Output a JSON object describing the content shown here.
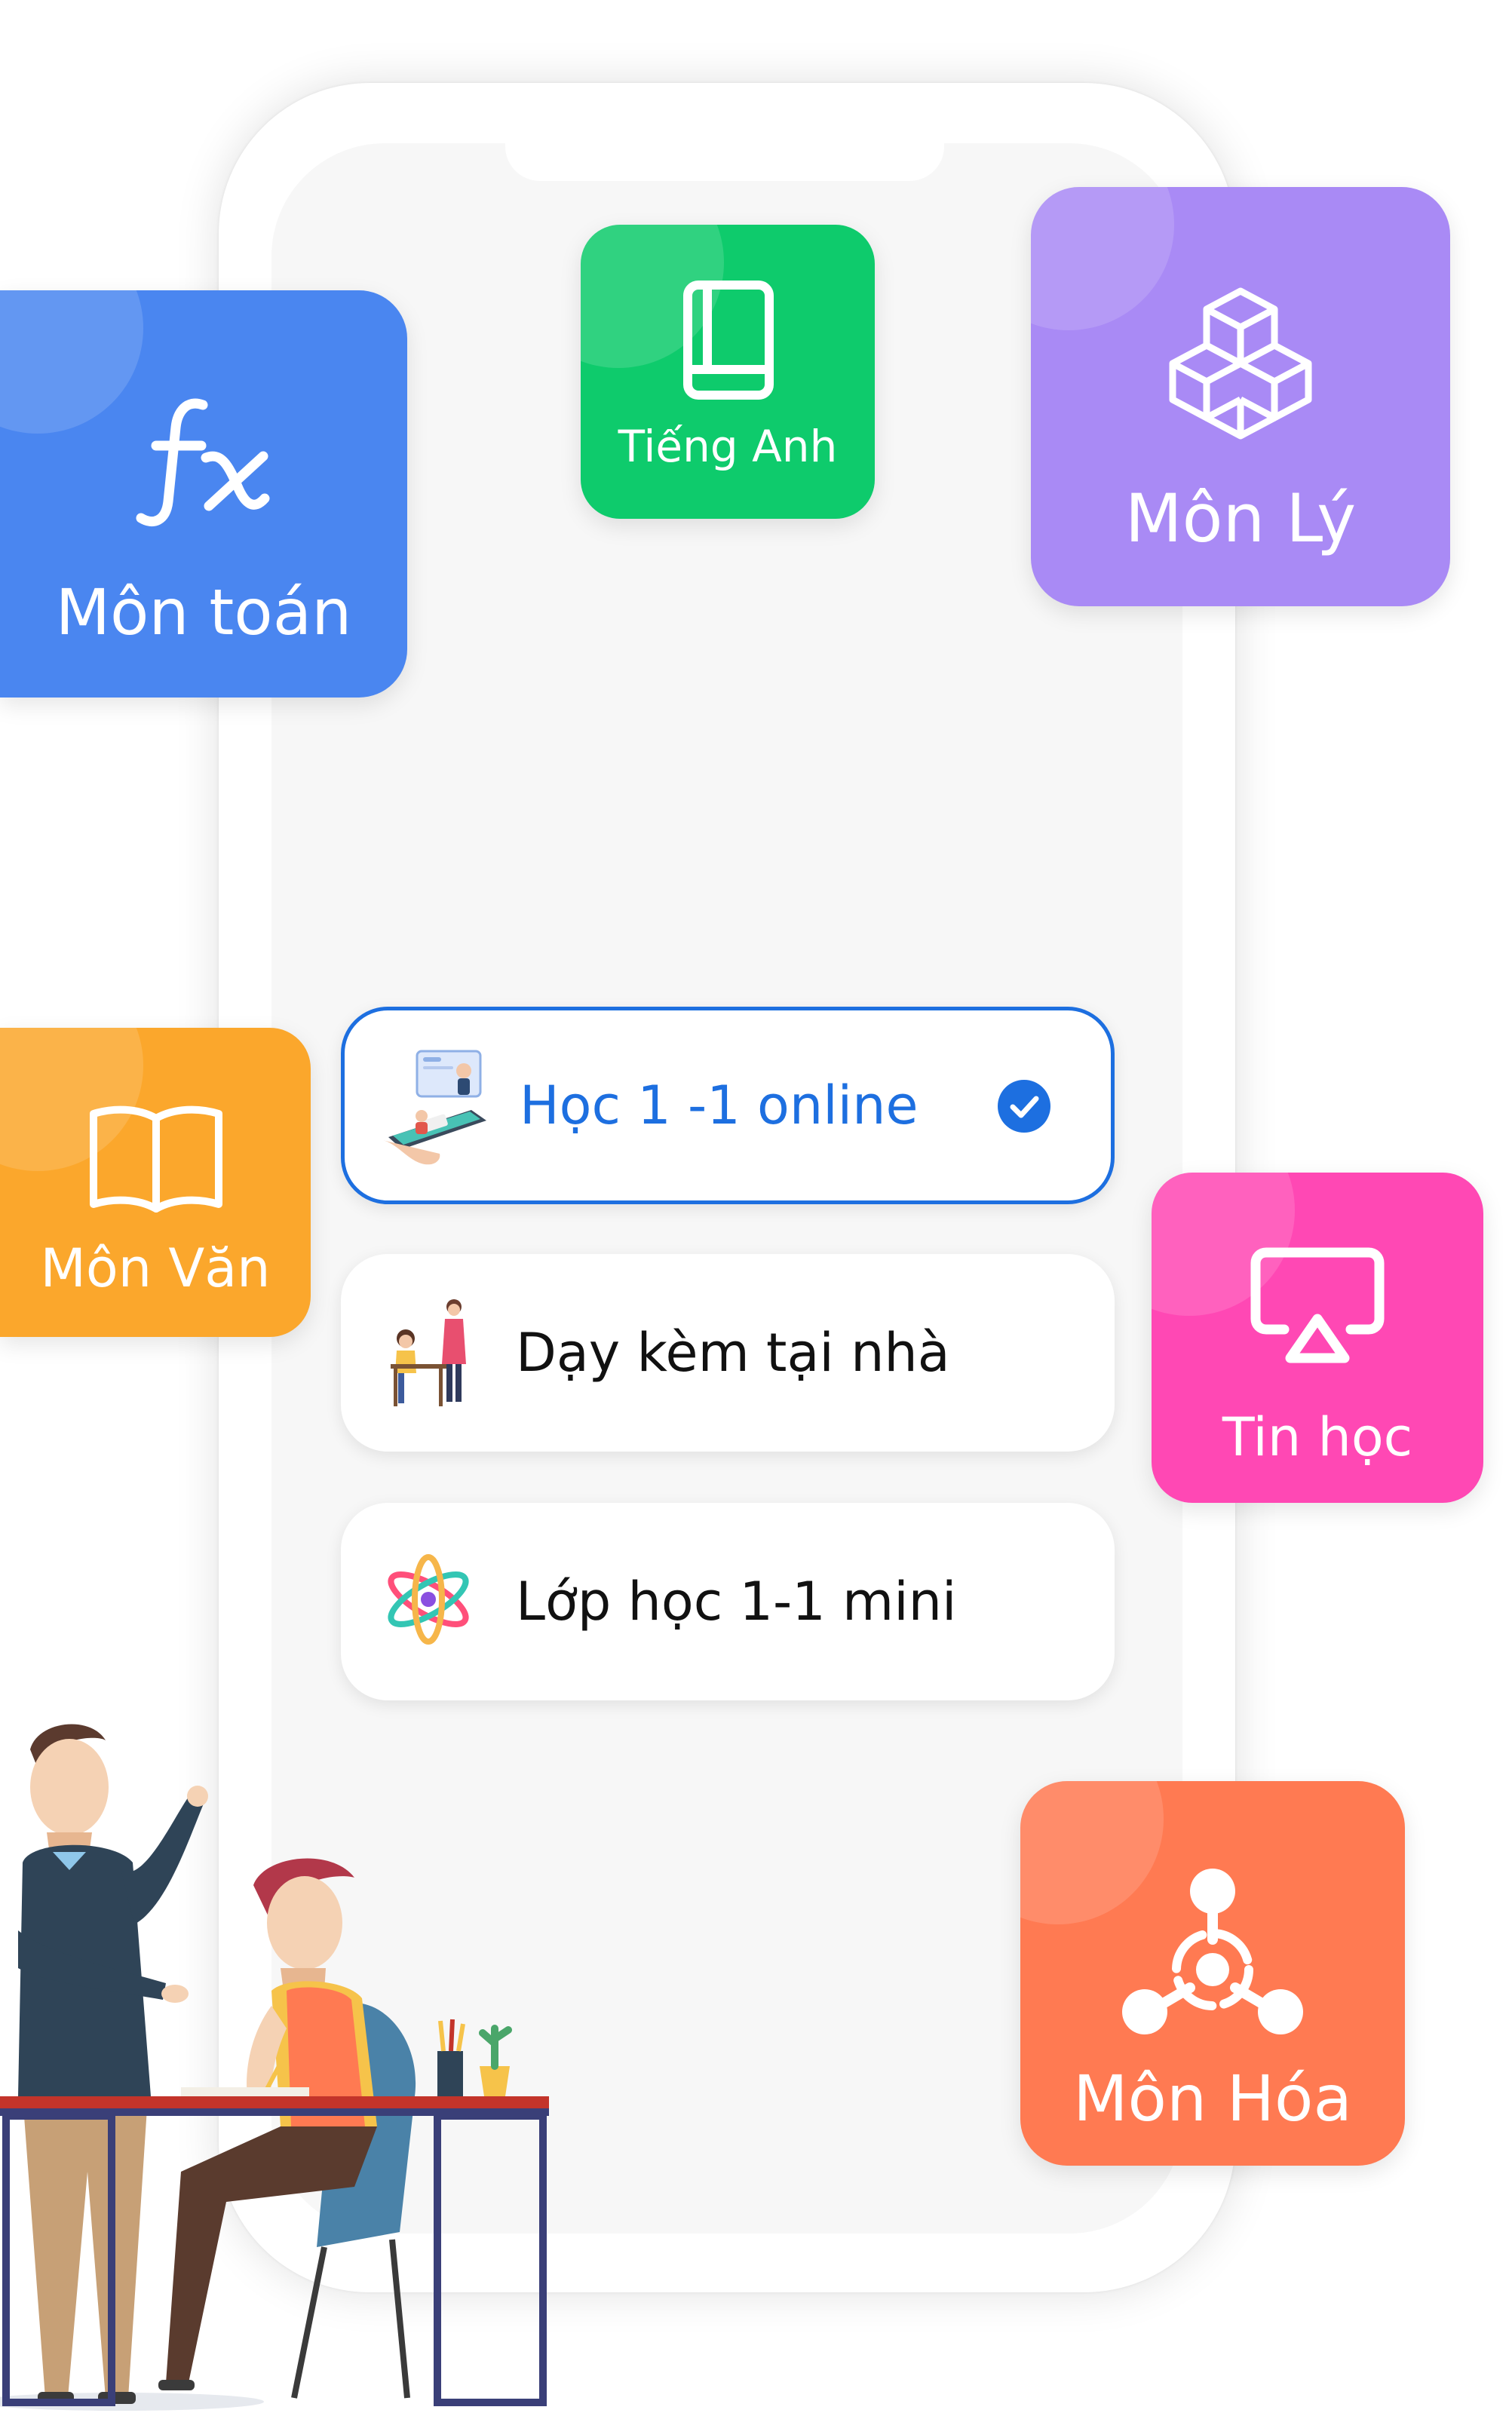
{
  "subjects": {
    "math": {
      "label": "Môn toán",
      "icon": "function-fx-icon",
      "color": "#4a86f0"
    },
    "english": {
      "label": "Tiếng Anh",
      "icon": "book-icon",
      "color": "#0ecb6c"
    },
    "physics": {
      "label": "Môn Lý",
      "icon": "cubes-icon",
      "color": "#a98af5"
    },
    "literature": {
      "label": "Môn Văn",
      "icon": "open-book-icon",
      "color": "#fba72c"
    },
    "informatics": {
      "label": "Tin học",
      "icon": "airplay-icon",
      "color": "#ff48b4"
    },
    "chemistry": {
      "label": "Môn Hóa",
      "icon": "molecule-icon",
      "color": "#ff7a52"
    }
  },
  "options": [
    {
      "label": "Học 1 -1 online",
      "icon": "online-class-icon",
      "selected": true
    },
    {
      "label": "Dạy kèm tại nhà",
      "icon": "home-tutor-icon",
      "selected": false
    },
    {
      "label": "Lớp học 1-1 mini",
      "icon": "atom-icon",
      "selected": false
    }
  ],
  "accent_color": "#1d6fe0"
}
